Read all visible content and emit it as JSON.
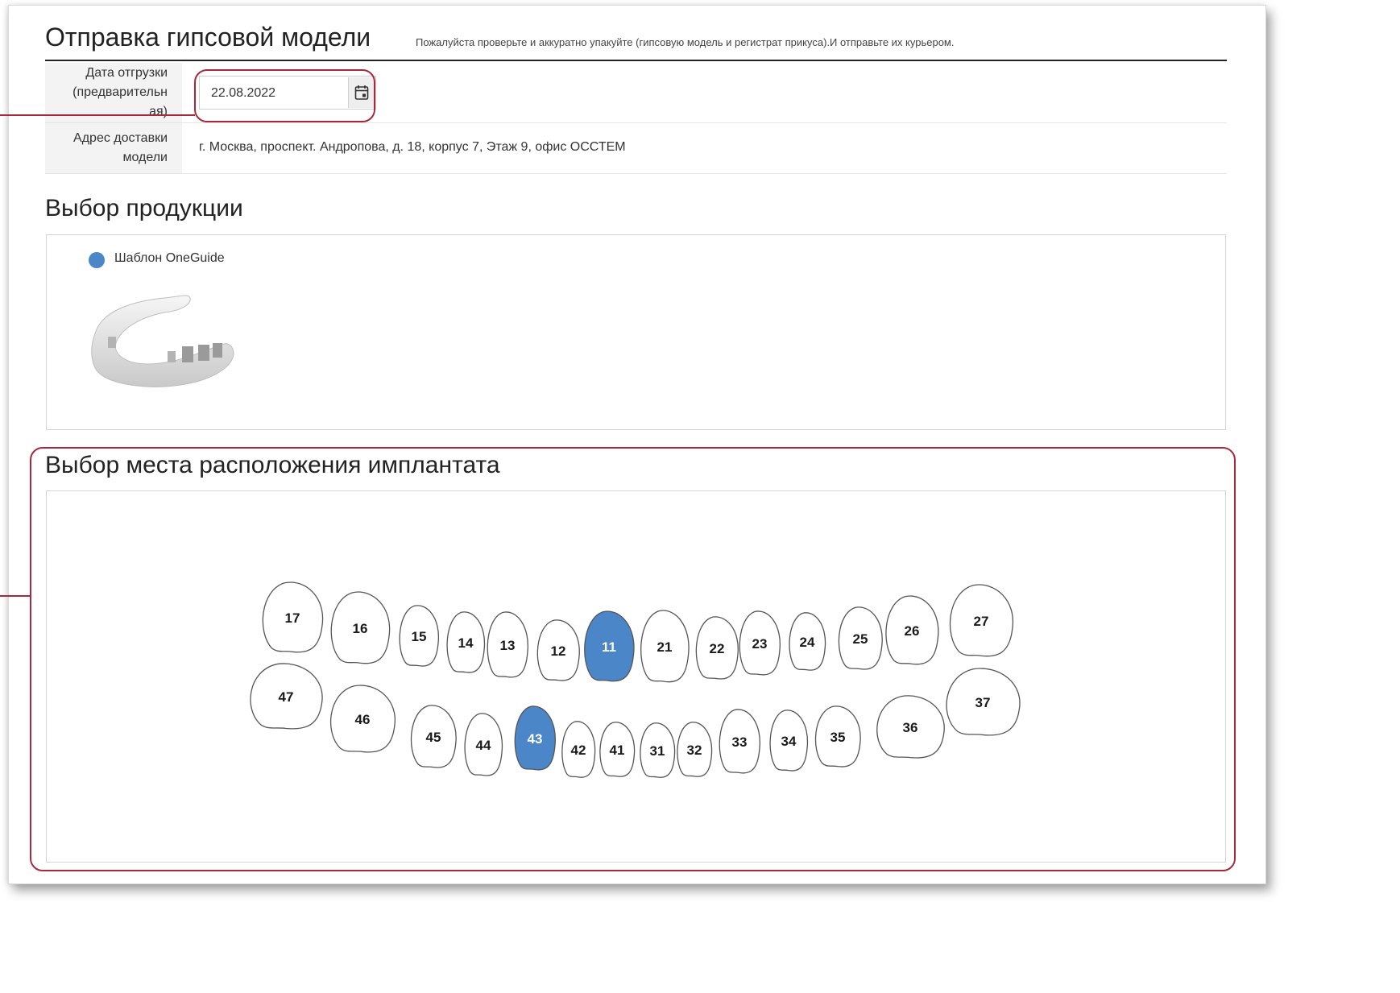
{
  "header": {
    "title": "Отправка гипсовой модели",
    "note": "Пожалуйста проверьте и аккуратно упакуйте (гипсовую модель и регистрат прикуса).И отправьте их курьером."
  },
  "form": {
    "date_label_1": "Дата отгрузки",
    "date_label_2": "(предварительн",
    "date_label_3": "ая)",
    "date_value": "22.08.2022",
    "address_label_1": "Адрес доставки",
    "address_label_2": "модели",
    "address_value": "г. Москва, проспект. Андропова, д. 18, корпус 7, Этаж 9, офис ОССТЕМ"
  },
  "products": {
    "title": "Выбор продукции",
    "option_label": "Шаблон OneGuide",
    "accent": "#4a86c8"
  },
  "implant": {
    "title": "Выбор места расположения имплантата",
    "selected_color": "#4a86c8",
    "selected_teeth": [
      "11",
      "43"
    ],
    "upper_teeth": [
      "17",
      "16",
      "15",
      "14",
      "13",
      "12",
      "11",
      "21",
      "22",
      "23",
      "24",
      "25",
      "26",
      "27"
    ],
    "lower_teeth": [
      "47",
      "46",
      "45",
      "44",
      "43",
      "42",
      "41",
      "31",
      "32",
      "33",
      "34",
      "35",
      "36",
      "37"
    ]
  },
  "callout_color": "#a8283b"
}
